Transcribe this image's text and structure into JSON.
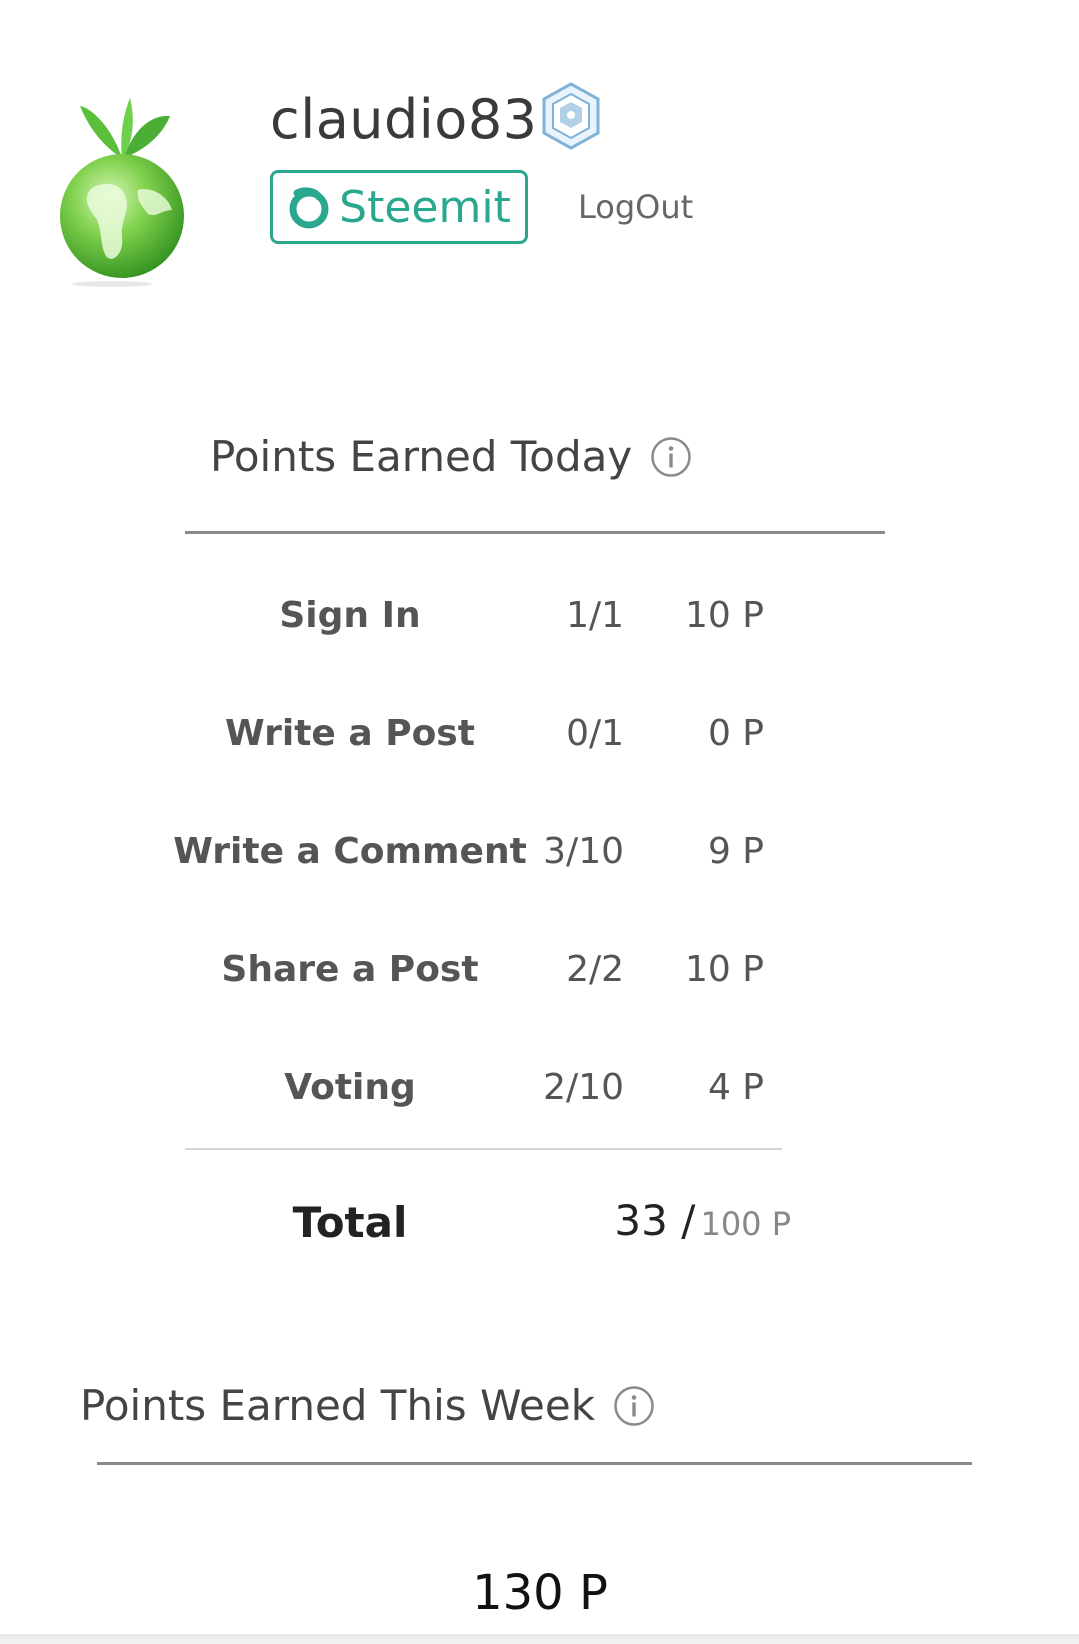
{
  "profile": {
    "username": "claudio83",
    "avatar_icon": "earth-plant-icon",
    "badge_icon": "hexagon-badge-icon",
    "steemit_label": "Steemit",
    "logout_label": "LogOut"
  },
  "today": {
    "title": "Points Earned Today",
    "rows": [
      {
        "name": "Sign In",
        "count": "1/1",
        "points": "10 P"
      },
      {
        "name": "Write a Post",
        "count": "0/1",
        "points": "0 P"
      },
      {
        "name": "Write a Comment",
        "count": "3/10",
        "points": "9 P"
      },
      {
        "name": "Share a Post",
        "count": "2/2",
        "points": "10 P"
      },
      {
        "name": "Voting",
        "count": "2/10",
        "points": "4 P"
      }
    ],
    "total_label": "Total",
    "total_earned": "33 /",
    "total_max": "100 P"
  },
  "week": {
    "title": "Points Earned This Week",
    "value": "130 P"
  },
  "colors": {
    "accent": "#2aa88f",
    "text": "#555555",
    "divider": "#8a8a8a"
  }
}
